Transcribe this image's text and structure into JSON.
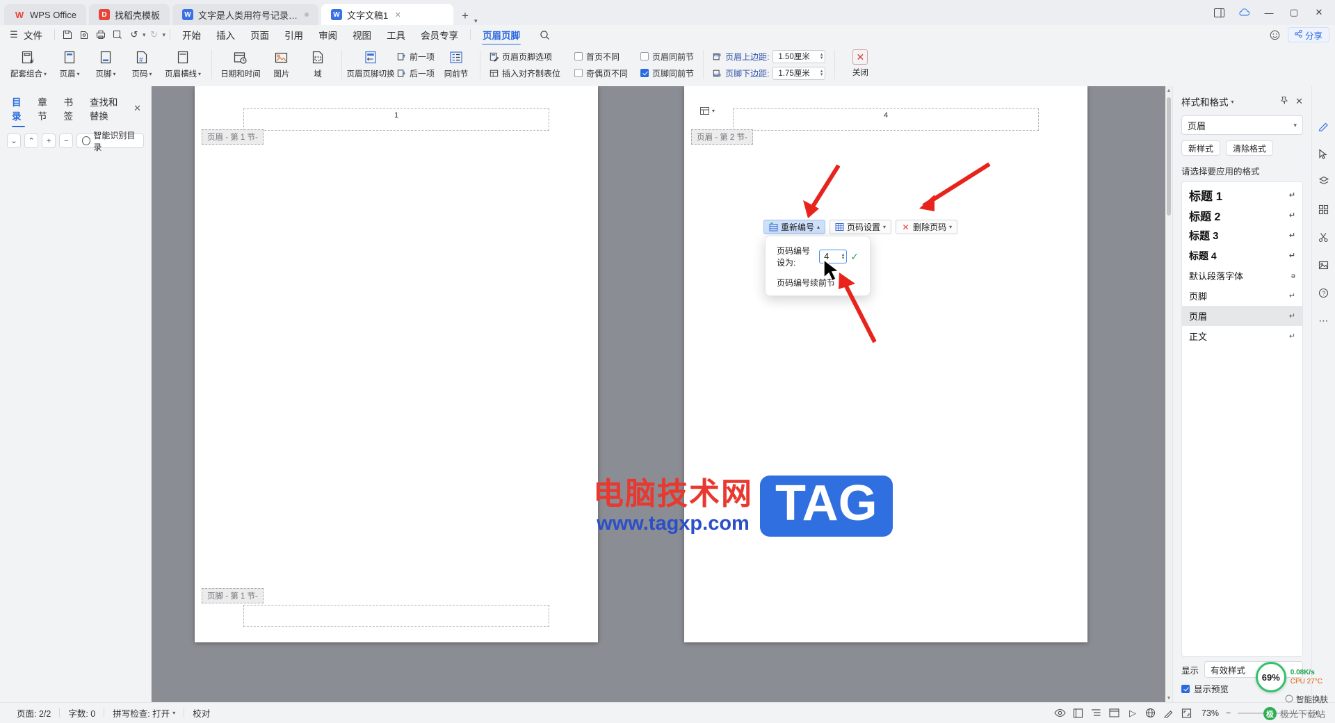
{
  "window": {
    "tabs": [
      {
        "label": "WPS Office",
        "icon": "wps-logo-icon",
        "kind": "home"
      },
      {
        "label": "找稻壳模板",
        "icon": "template-icon",
        "kind": "normal"
      },
      {
        "label": "文字是人类用符号记录表达信息以(",
        "icon": "word-doc-icon",
        "kind": "normal"
      },
      {
        "label": "文字文稿1",
        "icon": "word-doc-icon",
        "kind": "active"
      }
    ],
    "new_tab_label": "+",
    "controls": [
      "sidebar-toggle-icon",
      "cloud-icon",
      "minimize-icon",
      "maximize-icon",
      "close-icon"
    ]
  },
  "menubar": {
    "file_label": "文件",
    "quick_icons": [
      "save-icon",
      "save-as-icon",
      "print-icon",
      "print-preview-icon",
      "undo-icon",
      "redo-icon",
      "more-icon"
    ],
    "items": [
      "开始",
      "插入",
      "页面",
      "引用",
      "审阅",
      "视图",
      "工具",
      "会员专享"
    ],
    "active_item": "页眉页脚",
    "search_icon": "search-icon",
    "right_icons": [
      "smile-icon"
    ],
    "share_label": "分享"
  },
  "ribbon": {
    "group1": [
      {
        "label": "配套组合",
        "icon": "header-footer-combo-icon",
        "caret": true
      },
      {
        "label": "页眉",
        "icon": "header-icon",
        "caret": true
      },
      {
        "label": "页脚",
        "icon": "footer-icon",
        "caret": true
      },
      {
        "label": "页码",
        "icon": "page-number-icon",
        "caret": true
      },
      {
        "label": "页眉横线",
        "icon": "header-line-icon",
        "caret": true
      }
    ],
    "group2": [
      {
        "label": "日期和时间",
        "icon": "date-time-icon"
      },
      {
        "label": "图片",
        "icon": "picture-icon"
      },
      {
        "label": "域",
        "icon": "field-icon"
      }
    ],
    "group3": [
      {
        "label": "页眉页脚切换",
        "icon": "switch-header-footer-icon"
      }
    ],
    "group3_stack": [
      {
        "label": "前一项",
        "icon": "previous-item-icon"
      },
      {
        "label": "后一项",
        "icon": "next-item-icon"
      }
    ],
    "group3_same": {
      "label": "同前节",
      "icon": "same-as-previous-icon"
    },
    "group4": [
      {
        "label": "页眉页脚选项",
        "icon": "header-footer-options-icon"
      },
      {
        "label": "插入对齐制表位",
        "icon": "insert-align-tab-icon"
      }
    ],
    "checkboxes": [
      {
        "label": "首页不同",
        "checked": false
      },
      {
        "label": "奇偶页不同",
        "checked": false
      },
      {
        "label": "页眉同前节",
        "checked": false
      },
      {
        "label": "页脚同前节",
        "checked": true
      }
    ],
    "margins": [
      {
        "label": "页眉上边距:",
        "value": "1.50厘米",
        "icon": "header-top-margin-icon"
      },
      {
        "label": "页脚下边距:",
        "value": "1.75厘米",
        "icon": "footer-bottom-margin-icon"
      }
    ],
    "close": {
      "label": "关闭",
      "icon": "close-header-footer-icon"
    }
  },
  "navpanel": {
    "tabs": [
      "目录",
      "章节",
      "书签",
      "查找和替换"
    ],
    "active_tab": "目录",
    "close_icon": "close-icon",
    "tools": [
      "chevron-down-icon",
      "chevron-up-icon",
      "plus-icon",
      "minus-icon"
    ],
    "smart_label": "智能识别目录",
    "smart_icon": "smart-recognize-icon"
  },
  "document": {
    "page1": {
      "header_tag": "页眉 - 第 1 节-",
      "footer_tag": "页脚 - 第 1 节-",
      "page_number": "1"
    },
    "page2": {
      "header_tag": "页眉 - 第 2 节-",
      "page_number": "4"
    },
    "anchor_icon": "section-anchor-icon"
  },
  "hf_toolbar": {
    "buttons": [
      {
        "label": "重新编号",
        "icon": "renumber-icon",
        "selected": true,
        "caret": true
      },
      {
        "label": "页码设置",
        "icon": "page-number-settings-icon",
        "selected": false,
        "caret": true
      },
      {
        "label": "删除页码",
        "icon": "delete-page-number-icon",
        "selected": false,
        "caret": true
      }
    ]
  },
  "popup": {
    "field_label": "页码编号设为:",
    "field_value": "4",
    "confirm_icon": "check-icon",
    "link_label": "页码编号续前节"
  },
  "rightpanel": {
    "title": "样式和格式",
    "title_caret": "chevron-down-icon",
    "pin_icon": "pin-icon",
    "close_icon": "close-icon",
    "current_style": "页眉",
    "buttons": [
      "新样式",
      "清除格式"
    ],
    "list_label": "请选择要应用的格式",
    "styles": [
      {
        "label": "标题 1",
        "mark": "pilcrow-return-icon",
        "cls": "h1",
        "selected": false
      },
      {
        "label": "标题 2",
        "mark": "pilcrow-return-icon",
        "cls": "h2",
        "selected": false
      },
      {
        "label": "标题 3",
        "mark": "pilcrow-return-icon",
        "cls": "h3",
        "selected": false
      },
      {
        "label": "标题 4",
        "mark": "pilcrow-return-icon",
        "cls": "h4",
        "selected": false
      },
      {
        "label": "默认段落字体",
        "mark": "char-style-icon",
        "cls": "",
        "selected": false
      },
      {
        "label": "页脚",
        "mark": "pilcrow-return-icon",
        "cls": "",
        "selected": false
      },
      {
        "label": "页眉",
        "mark": "pilcrow-return-icon",
        "cls": "",
        "selected": true
      },
      {
        "label": "正文",
        "mark": "pilcrow-return-icon",
        "cls": "",
        "selected": false
      }
    ],
    "show_label": "显示",
    "show_value": "有效样式",
    "preview_label": "显示预览",
    "preview_checked": true
  },
  "iconstrip": [
    "pen-edit-icon",
    "cursor-icon",
    "layers-icon",
    "grid-icon",
    "scissors-icon",
    "image-tool-icon",
    "help-icon",
    "more-dots-icon"
  ],
  "statusbar": {
    "page_label": "页面: 2/2",
    "words_label": "字数: 0",
    "spellcheck_label": "拼写检查: 打开",
    "proof_label": "校对",
    "right_icons": [
      "eye-icon",
      "page-view-icon",
      "outline-view-icon",
      "web-view-icon",
      "play-icon",
      "globe-icon",
      "pen-icon",
      "fit-page-icon"
    ],
    "zoom_value": "73%",
    "zoom_minus": "−",
    "zoom_plus": "+"
  },
  "overlays": {
    "cpu_percent": "69%",
    "net_speed": "0.08K/s",
    "cpu_temp": "CPU 27°C",
    "smart_panel": "智能换肤",
    "watermark_cn": "电脑技术网",
    "watermark_url": "www.tagxp.com",
    "watermark_tag": "TAG",
    "download_site": "极光下载站"
  },
  "colors": {
    "accent": "#2a6ae0",
    "selected_blue": "#cfe0fb",
    "arrow_red": "#e8231c",
    "canvas_gray": "#8a8d93",
    "chrome_gray": "#f2f3f5"
  }
}
